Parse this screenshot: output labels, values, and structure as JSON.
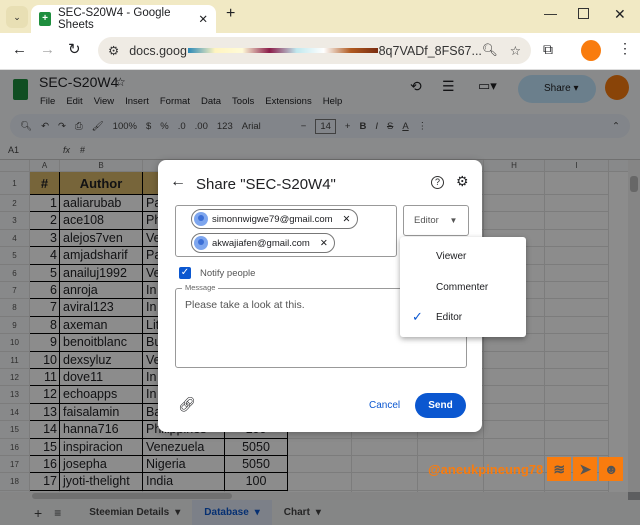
{
  "browser": {
    "tab_title": "SEC-S20W4 - Google Sheets",
    "url_start": "docs.goog",
    "url_end": "8q7VADf_8FS67..."
  },
  "sheets": {
    "doc_title": "SEC-S20W4",
    "menu": [
      "File",
      "Edit",
      "View",
      "Insert",
      "Format",
      "Data",
      "Tools",
      "Extensions",
      "Help"
    ],
    "share_label": "Share",
    "toolbar": {
      "zoom": "100%",
      "currency": "$",
      "percent": "%",
      "dec_less": ".0",
      "dec_more": ".00",
      "format": "123",
      "font": "Arial",
      "font_size": "14",
      "bold": "B",
      "italic": "I",
      "strike": "S",
      "textcolor": "A"
    },
    "name_box": "A1",
    "formula": "#",
    "columns": [
      "A",
      "B",
      "C",
      "D",
      "E",
      "F",
      "G",
      "H",
      "I"
    ],
    "header_row": [
      "#",
      "Author"
    ],
    "rows": [
      [
        "1",
        "aaliarubab",
        "Pa",
        ""
      ],
      [
        "2",
        "ace108",
        "Ph",
        ""
      ],
      [
        "3",
        "alejos7ven",
        "Ve",
        ""
      ],
      [
        "4",
        "amjadsharif",
        "Pa",
        ""
      ],
      [
        "5",
        "anailuj1992",
        "Ve",
        ""
      ],
      [
        "6",
        "anroja",
        "In",
        ""
      ],
      [
        "7",
        "aviral123",
        "In",
        ""
      ],
      [
        "8",
        "axeman",
        "Lit",
        ""
      ],
      [
        "9",
        "benoitblanc",
        "Bu",
        ""
      ],
      [
        "10",
        "dexsyluz",
        "Ve",
        ""
      ],
      [
        "11",
        "dove11",
        "In",
        ""
      ],
      [
        "12",
        "echoapps",
        "In",
        ""
      ],
      [
        "13",
        "faisalamin",
        "Ba",
        ""
      ],
      [
        "14",
        "hanna716",
        "Philippines",
        "100"
      ],
      [
        "15",
        "inspiracion",
        "Venezuela",
        "5050"
      ],
      [
        "16",
        "josepha",
        "Nigeria",
        "5050"
      ],
      [
        "17",
        "jyoti-thelight",
        "India",
        "100"
      ]
    ],
    "sheet_tabs": [
      "Steemian Details",
      "Database",
      "Chart"
    ],
    "active_tab": "Database"
  },
  "dialog": {
    "title": "Share \"SEC-S20W4\"",
    "recipients": [
      "simonnwigwe79@gmail.com",
      "akwajiafen@gmail.com"
    ],
    "role": "Editor",
    "notify_label": "Notify people",
    "notify_checked": true,
    "message_label": "Message",
    "message": "Please take a look at this.",
    "cancel": "Cancel",
    "send": "Send"
  },
  "role_menu": {
    "options": [
      "Viewer",
      "Commenter",
      "Editor"
    ],
    "selected": "Editor"
  },
  "watermark": "@aneukpineung78",
  "colors": {
    "accent": "#0b57d0",
    "avatar": "#f97c0e",
    "header_fill": "#d9b86a",
    "watermark": "#f97c0e"
  }
}
